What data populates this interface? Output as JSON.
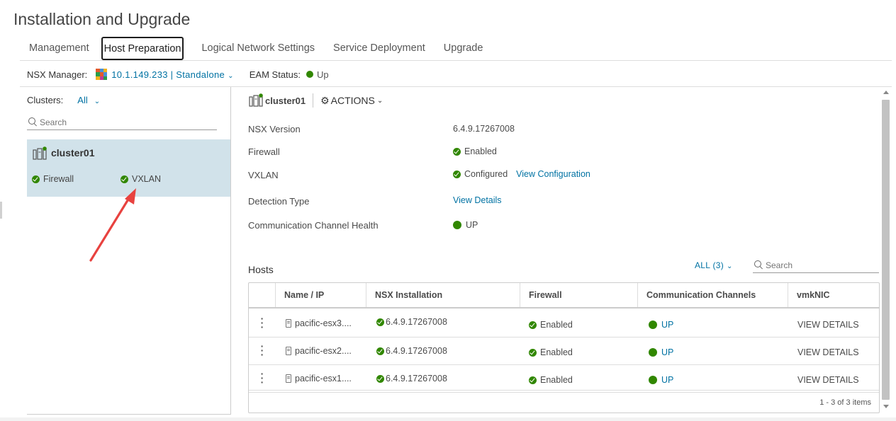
{
  "page": {
    "title": "Installation and Upgrade"
  },
  "tabs": [
    {
      "label": "Management"
    },
    {
      "label": "Host Preparation",
      "active": true
    },
    {
      "label": "Logical Network Settings"
    },
    {
      "label": "Service Deployment"
    },
    {
      "label": "Upgrade"
    }
  ],
  "manager": {
    "label": "NSX Manager:",
    "value": "10.1.149.233 | Standalone",
    "eam_label": "EAM Status:",
    "eam_value": "Up"
  },
  "clusters": {
    "label": "Clusters:",
    "filter": "All",
    "search_placeholder": "Search",
    "items": [
      {
        "name": "cluster01",
        "firewall": "Firewall",
        "vxlan": "VXLAN"
      }
    ]
  },
  "detail": {
    "cluster_name": "cluster01",
    "actions_label": "ACTIONS",
    "props": {
      "nsx_version_label": "NSX Version",
      "nsx_version_value": "6.4.9.17267008",
      "firewall_label": "Firewall",
      "firewall_value": "Enabled",
      "vxlan_label": "VXLAN",
      "vxlan_value": "Configured",
      "vxlan_link": "View Configuration",
      "detection_label": "Detection Type",
      "detection_link": "View Details",
      "channel_label": "Communication Channel Health",
      "channel_value": "UP"
    }
  },
  "hosts": {
    "title": "Hosts",
    "filter": "ALL (3)",
    "search_placeholder": "Search",
    "columns": [
      "Name / IP",
      "NSX Installation",
      "Firewall",
      "Communication Channels",
      "vmkNIC"
    ],
    "rows": [
      {
        "name": "pacific-esx3....",
        "install": "6.4.9.17267008",
        "firewall": "Enabled",
        "channels": "UP",
        "vmknic": "VIEW DETAILS"
      },
      {
        "name": "pacific-esx2....",
        "install": "6.4.9.17267008",
        "firewall": "Enabled",
        "channels": "UP",
        "vmknic": "VIEW DETAILS"
      },
      {
        "name": "pacific-esx1....",
        "install": "6.4.9.17267008",
        "firewall": "Enabled",
        "channels": "UP",
        "vmknic": "VIEW DETAILS"
      }
    ],
    "footer": "1 - 3 of 3 items"
  },
  "colors": {
    "link": "#0072a3",
    "status_green": "#318700",
    "selected_card": "#d1e2ea",
    "annotation_arrow": "#e8423f"
  },
  "icons": {
    "manager": "nsx-manager-icon",
    "cluster": "cluster-icon",
    "actions": "gear-icon",
    "search": "search-icon",
    "host": "host-icon",
    "row_menu": "kebab-menu-icon",
    "annotation": "red-arrow-annotation"
  }
}
